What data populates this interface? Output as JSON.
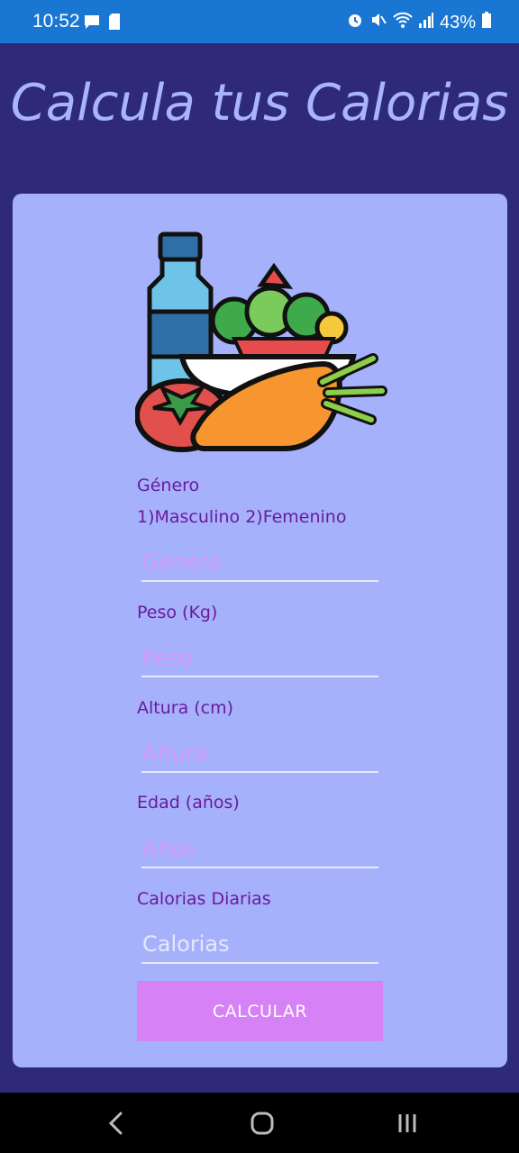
{
  "status_bar": {
    "time": "10:52",
    "battery": "43%",
    "icons": [
      "message-icon",
      "sim-card-icon",
      "alarm-icon",
      "mute-icon",
      "wifi-icon",
      "signal-icon",
      "battery-icon"
    ]
  },
  "app": {
    "title": "Calcula tus Calorias"
  },
  "form": {
    "gender_label": "Género",
    "gender_options": "1)Masculino  2)Femenino",
    "gender_placeholder": "Genero",
    "weight_label": "Peso (Kg)",
    "weight_placeholder": "Peso",
    "height_label": "Altura (cm)",
    "height_placeholder": "Altura",
    "age_label": "Edad (años)",
    "age_placeholder": "Años",
    "calories_label": "Calorias Diarias",
    "calories_placeholder": "Calorias",
    "calculate_button": "CALCULAR"
  },
  "colors": {
    "background": "#2e2a78",
    "card": "#a6b1fc",
    "title": "#a9b3ff",
    "label": "#6a1b9a",
    "button": "#d681f5",
    "status_bar": "#1976d2"
  },
  "nav_bar": {
    "icons": [
      "back-icon",
      "home-icon",
      "recent-apps-icon"
    ]
  }
}
